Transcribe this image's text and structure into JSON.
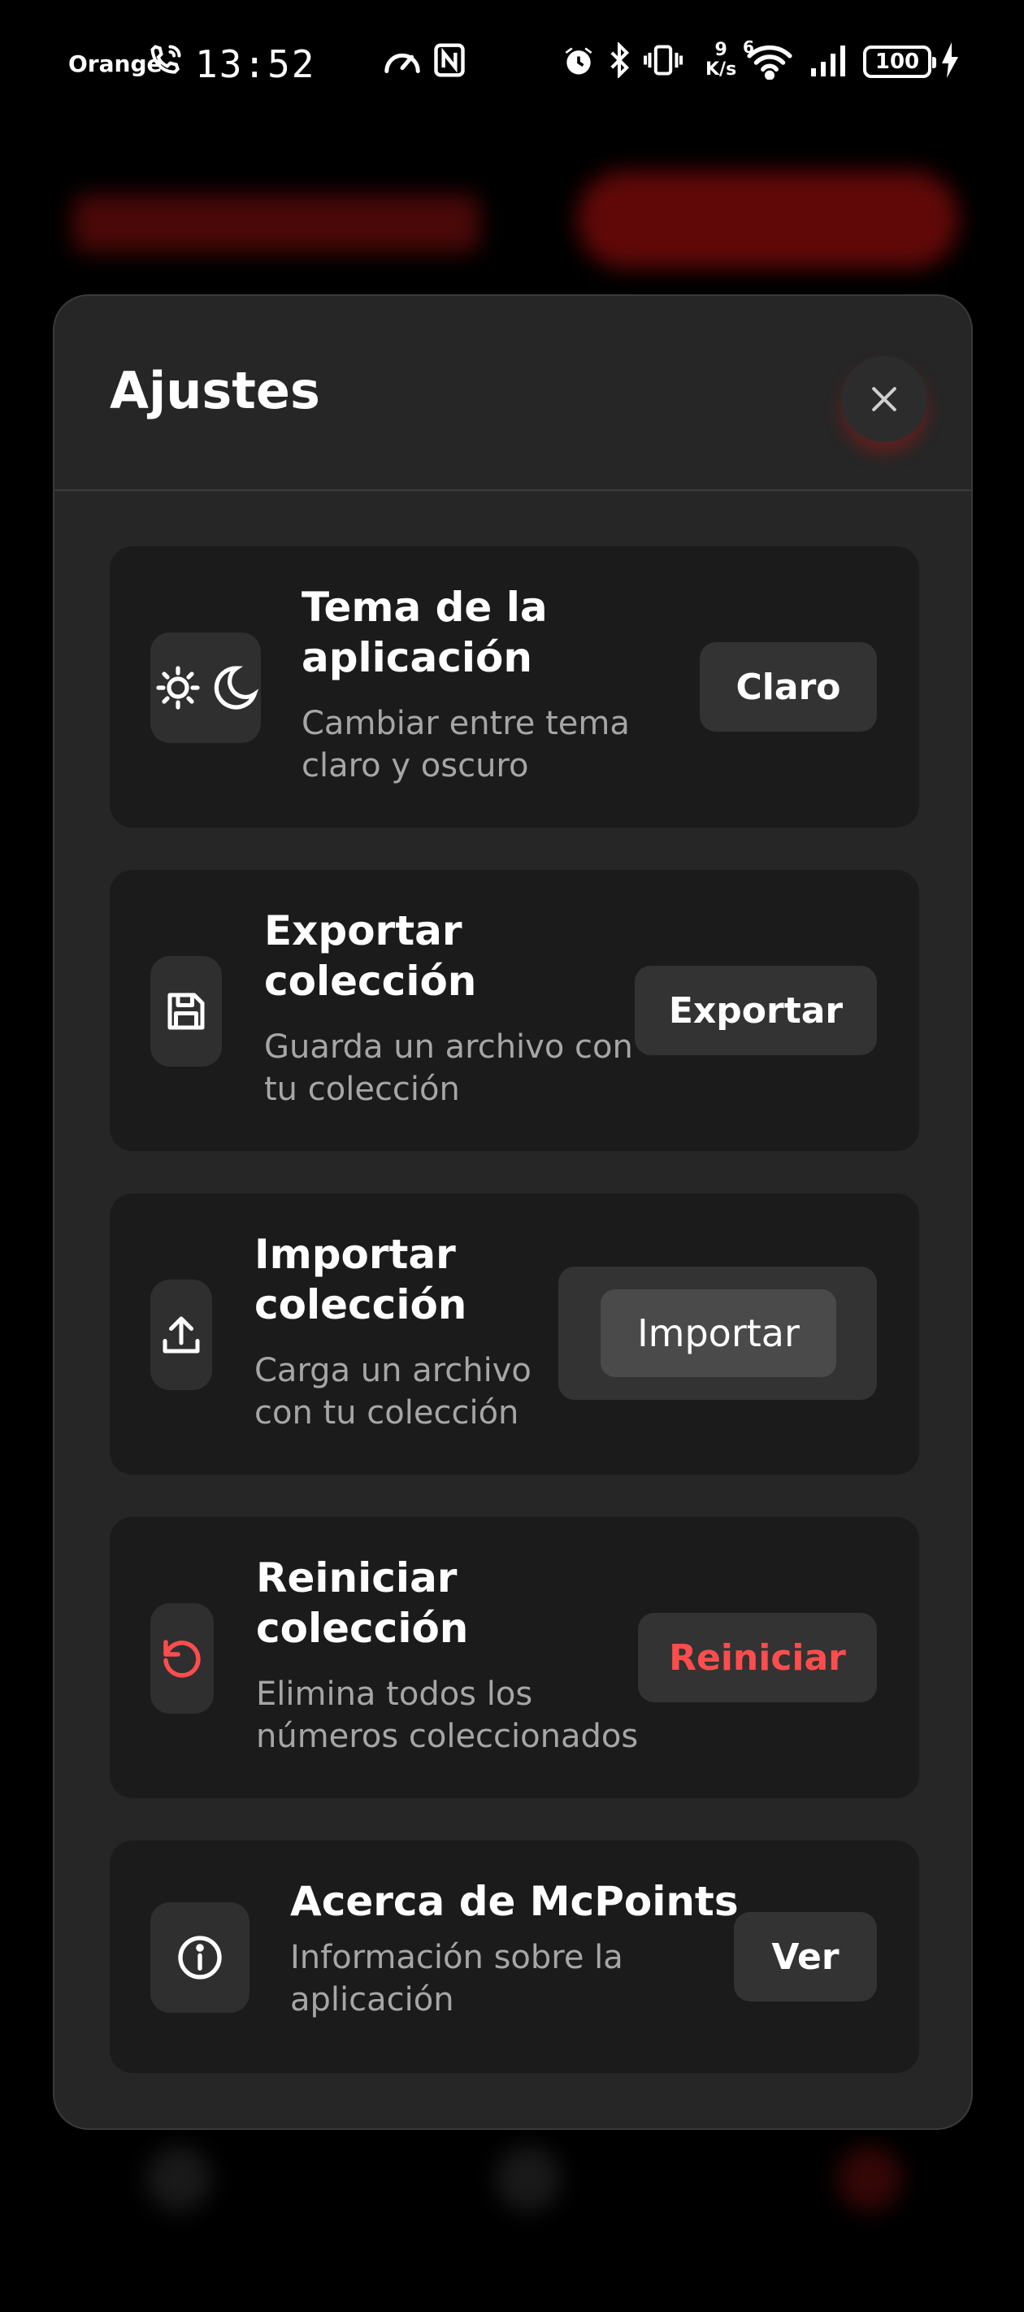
{
  "status_bar": {
    "carrier": "Orange",
    "time": "13:52",
    "net_speed_value": "9",
    "net_speed_unit": "K/s",
    "wifi_label": "6",
    "battery": "100",
    "icons": [
      "wifi-calling-icon",
      "speedometer-icon",
      "nfc-icon",
      "alarm-icon",
      "bluetooth-icon",
      "vibrate-icon",
      "wifi-icon",
      "signal-icon",
      "charging-icon"
    ]
  },
  "settings": {
    "title": "Ajustes",
    "items": [
      {
        "title_line1": "Tema de la",
        "title_line2": "aplicación",
        "desc_line1": "Cambiar entre tema",
        "desc_line2": "claro y oscuro",
        "action": "Claro",
        "icon": "theme-sun-moon-icon"
      },
      {
        "title_line1": "Exportar",
        "title_line2": "colección",
        "desc_line1": "Guarda un archivo con",
        "desc_line2": "tu colección",
        "action": "Exportar",
        "icon": "save-floppy-icon"
      },
      {
        "title_line1": "Importar",
        "title_line2": "colección",
        "desc_line1": "Carga un archivo",
        "desc_line2": "con tu colección",
        "action": "Importar",
        "icon": "upload-icon"
      },
      {
        "title_line1": "Reiniciar",
        "title_line2": "colección",
        "desc_line1": "Elimina todos los",
        "desc_line2": "números coleccionados",
        "action": "Reiniciar",
        "icon": "reset-icon",
        "action_color": "#ff4d4d"
      },
      {
        "title_line1": "Acerca de McPoints",
        "desc_line1": "Información sobre la",
        "desc_line2": "aplicación",
        "action": "Ver",
        "icon": "info-icon"
      }
    ]
  },
  "colors": {
    "modal_bg": "#262626",
    "card_bg": "#1b1b1b",
    "button_bg": "#333333",
    "danger": "#ff4d4d"
  }
}
